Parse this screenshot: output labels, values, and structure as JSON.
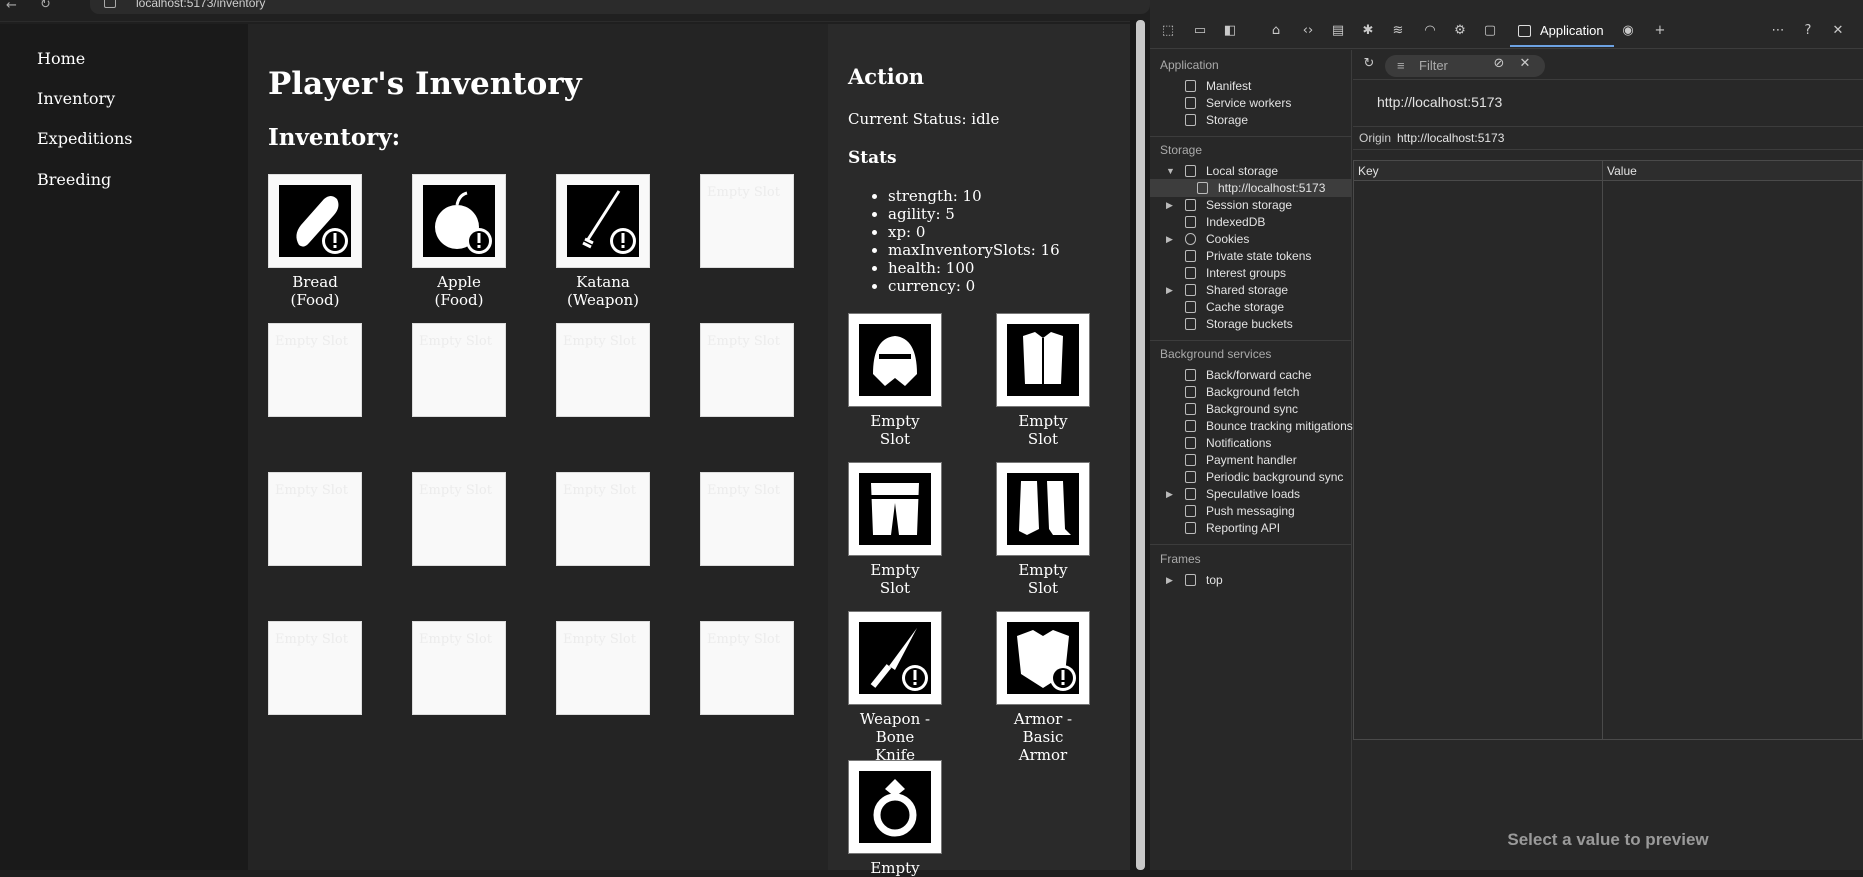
{
  "browser": {
    "url": "localhost:5173/inventory"
  },
  "nav": {
    "items": [
      "Home",
      "Inventory",
      "Expeditions",
      "Breeding"
    ]
  },
  "main": {
    "title": "Player's Inventory",
    "section": "Inventory:",
    "slots": [
      {
        "label": "Bread\n(Food)",
        "icon": "bread-icon",
        "filled": true
      },
      {
        "label": "Apple\n(Food)",
        "icon": "apple-icon",
        "filled": true
      },
      {
        "label": "Katana\n(Weapon)",
        "icon": "katana-icon",
        "filled": true
      },
      {
        "label": "Empty Slot",
        "filled": false
      },
      {
        "label": "Empty Slot",
        "filled": false
      },
      {
        "label": "Empty Slot",
        "filled": false
      },
      {
        "label": "Empty Slot",
        "filled": false
      },
      {
        "label": "Empty Slot",
        "filled": false
      },
      {
        "label": "Empty Slot",
        "filled": false
      },
      {
        "label": "Empty Slot",
        "filled": false
      },
      {
        "label": "Empty Slot",
        "filled": false
      },
      {
        "label": "Empty Slot",
        "filled": false
      },
      {
        "label": "Empty Slot",
        "filled": false
      },
      {
        "label": "Empty Slot",
        "filled": false
      },
      {
        "label": "Empty Slot",
        "filled": false
      },
      {
        "label": "Empty Slot",
        "filled": false
      }
    ]
  },
  "action": {
    "title": "Action",
    "status": "Current Status: idle",
    "stats_title": "Stats",
    "stats": [
      "strength: 10",
      "agility: 5",
      "xp: 0",
      "maxInventorySlots: 16",
      "health: 100",
      "currency: 0"
    ],
    "equipment": [
      {
        "label": "Empty\nSlot",
        "icon": "helmet-icon"
      },
      {
        "label": "Empty\nSlot",
        "icon": "chest-armor-icon"
      },
      {
        "label": "Empty\nSlot",
        "icon": "leg-armor-icon"
      },
      {
        "label": "Empty\nSlot",
        "icon": "boots-icon"
      },
      {
        "label": "Weapon -\nBone\nKnife",
        "icon": "knife-icon"
      },
      {
        "label": "Armor -\nBasic\nArmor",
        "icon": "armor-icon"
      },
      {
        "label": "Empty",
        "icon": "ring-icon"
      }
    ]
  },
  "devtools": {
    "active_tab": "Application",
    "app_section": "Application",
    "app_items": [
      "Manifest",
      "Service workers",
      "Storage"
    ],
    "storage_section": "Storage",
    "storage_items": [
      "Local storage",
      "http://localhost:5173",
      "Session storage",
      "IndexedDB",
      "Cookies",
      "Private state tokens",
      "Interest groups",
      "Shared storage",
      "Cache storage",
      "Storage buckets"
    ],
    "bg_section": "Background services",
    "bg_items": [
      "Back/forward cache",
      "Background fetch",
      "Background sync",
      "Bounce tracking mitigations",
      "Notifications",
      "Payment handler",
      "Periodic background sync",
      "Speculative loads",
      "Push messaging",
      "Reporting API"
    ],
    "frames_section": "Frames",
    "frames_items": [
      "top"
    ],
    "filter_placeholder": "Filter",
    "origin_url": "http://localhost:5173",
    "origin_label": "Origin",
    "origin_value": "http://localhost:5173",
    "col_key": "Key",
    "col_value": "Value",
    "preview": "Select a value to preview"
  }
}
